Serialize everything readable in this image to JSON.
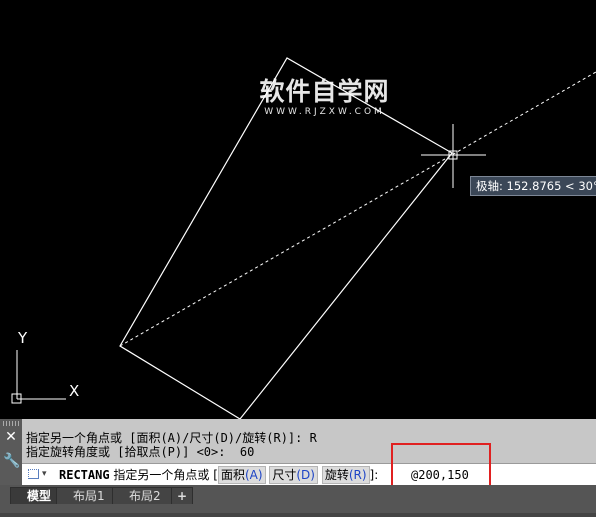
{
  "watermark": {
    "main": "软件自学网",
    "sub": "WWW.RJZXW.COM"
  },
  "tooltip": {
    "text": "极轴: 152.8765 < 30°"
  },
  "ucs": {
    "x_label": "X",
    "y_label": "Y"
  },
  "command_history": [
    "指定另一个角点或 [面积(A)/尺寸(D)/旋转(R)]: R",
    "指定旋转角度或 [拾取点(P)] <0>:  60"
  ],
  "command_line": {
    "command": "RECTANG",
    "prompt": "指定另一个角点或",
    "open_bracket": "[",
    "options": [
      {
        "label": "面积",
        "key": "(A)"
      },
      {
        "label": "尺寸",
        "key": "(D)"
      },
      {
        "label": "旋转",
        "key": "(R)"
      }
    ],
    "close_bracket": "]:",
    "input_value": "@200,150"
  },
  "tabs": {
    "model": "模型",
    "layout1": "布局1",
    "layout2": "布局2",
    "add": "+"
  },
  "icons": {
    "close": "close-icon",
    "customize": "wrench-icon",
    "command": "command-icon"
  },
  "colors": {
    "background": "#000000",
    "annotation": "#e02020",
    "option_key": "#1d44c6"
  }
}
